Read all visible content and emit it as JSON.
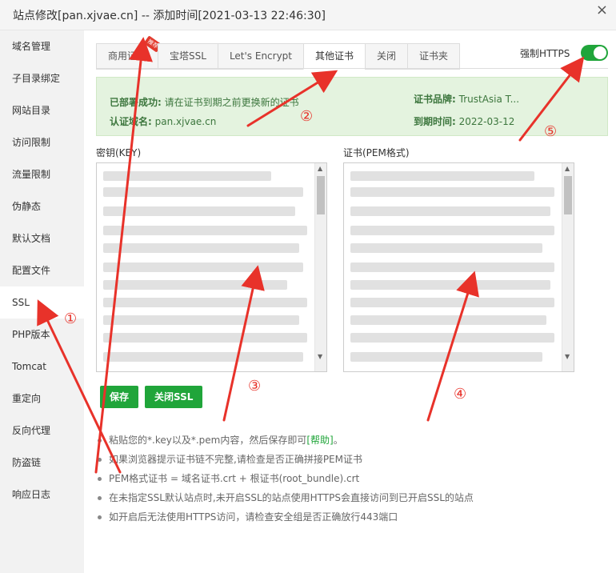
{
  "window": {
    "title": "站点修改[pan.xjvae.cn] -- 添加时间[2021-03-13 22:46:30]"
  },
  "sidebar": {
    "items": [
      {
        "label": "域名管理"
      },
      {
        "label": "子目录绑定"
      },
      {
        "label": "网站目录"
      },
      {
        "label": "访问限制"
      },
      {
        "label": "流量限制"
      },
      {
        "label": "伪静态"
      },
      {
        "label": "默认文档"
      },
      {
        "label": "配置文件"
      },
      {
        "label": "SSL"
      },
      {
        "label": "PHP版本"
      },
      {
        "label": "Tomcat"
      },
      {
        "label": "重定向"
      },
      {
        "label": "反向代理"
      },
      {
        "label": "防盗链"
      },
      {
        "label": "响应日志"
      }
    ],
    "active_index": 8
  },
  "tabs": [
    {
      "label": "商用证书",
      "badge": "推荐"
    },
    {
      "label": "宝塔SSL"
    },
    {
      "label": "Let's Encrypt"
    },
    {
      "label": "其他证书"
    },
    {
      "label": "关闭"
    },
    {
      "label": "证书夹"
    }
  ],
  "force_https": {
    "label": "强制HTTPS",
    "on": true
  },
  "status": {
    "deploy_label": "已部署成功:",
    "deploy_text": "请在证书到期之前更换新的证书",
    "domain_label": "认证域名:",
    "domain_value": "pan.xjvae.cn",
    "brand_label": "证书品牌:",
    "brand_value": "TrustAsia T...",
    "expire_label": "到期时间:",
    "expire_value": "2022-03-12"
  },
  "key_field": {
    "label": "密钥(KEY)"
  },
  "cert_field": {
    "label": "证书(PEM格式)"
  },
  "buttons": {
    "save": "保存",
    "close_ssl": "关闭SSL"
  },
  "tips": [
    {
      "text": "粘贴您的*.key以及*.pem内容，然后保存即可",
      "help": "[帮助]",
      "suffix": "。"
    },
    {
      "text": "如果浏览器提示证书链不完整,请检查是否正确拼接PEM证书"
    },
    {
      "text": "PEM格式证书 = 域名证书.crt + 根证书(root_bundle).crt"
    },
    {
      "text": "在未指定SSL默认站点时,未开启SSL的站点使用HTTPS会直接访问到已开启SSL的站点"
    },
    {
      "text": "如开启后无法使用HTTPS访问，请检查安全组是否正确放行443端口"
    }
  ],
  "annotations": [
    "①",
    "②",
    "③",
    "④",
    "⑤"
  ],
  "colors": {
    "accent": "#20a53a",
    "arrow": "#e8322a",
    "info_bg": "#e4f3df"
  }
}
